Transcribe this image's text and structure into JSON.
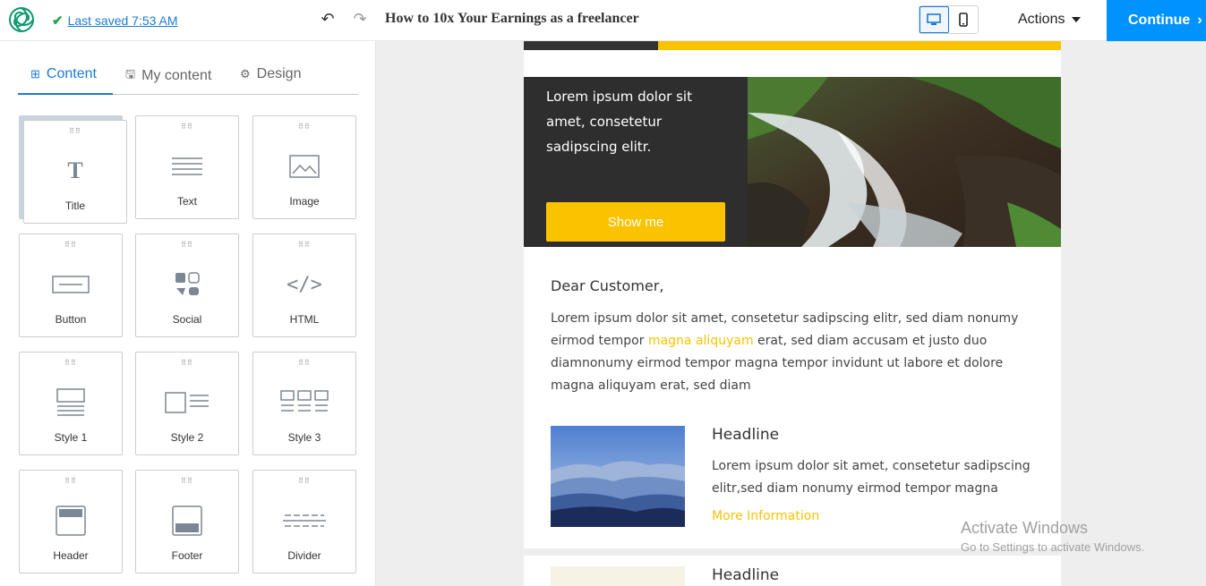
{
  "topbar": {
    "logo_icon": "sendinblue-spiral-icon",
    "last_saved": "Last saved 7:53 AM",
    "undo_icon": "undo-icon",
    "redo_icon": "redo-icon",
    "document_title": "How to 10x Your Earnings as a freelancer",
    "device_desktop_icon": "desktop-icon",
    "device_mobile_icon": "mobile-icon",
    "actions_label": "Actions",
    "continue_label": "Continue",
    "accent_color": "#0092ff"
  },
  "sidebar": {
    "tabs": [
      {
        "label": "Content",
        "icon": "grid-icon",
        "active": true
      },
      {
        "label": "My content",
        "icon": "save-icon",
        "active": false
      },
      {
        "label": "Design",
        "icon": "gear-icon",
        "active": false
      }
    ],
    "blocks": [
      {
        "label": "Title",
        "icon": "title-icon"
      },
      {
        "label": "Text",
        "icon": "text-icon"
      },
      {
        "label": "Image",
        "icon": "image-icon"
      },
      {
        "label": "Button",
        "icon": "button-icon"
      },
      {
        "label": "Social",
        "icon": "social-icon"
      },
      {
        "label": "HTML",
        "icon": "code-icon"
      },
      {
        "label": "Style 1",
        "icon": "style1-icon"
      },
      {
        "label": "Style 2",
        "icon": "style2-icon"
      },
      {
        "label": "Style 3",
        "icon": "style3-icon"
      },
      {
        "label": "Header",
        "icon": "header-icon"
      },
      {
        "label": "Footer",
        "icon": "footer-icon"
      },
      {
        "label": "Divider",
        "icon": "divider-icon"
      }
    ]
  },
  "email": {
    "hero_text": "Lorem ipsum dolor sit amet, consetetur sadipscing elitr.",
    "hero_button": "Show me",
    "greeting": "Dear Customer,",
    "paragraph_before": "Lorem ipsum dolor sit amet, consetetur sadipscing elitr, sed diam nonumy eirmod tempor ",
    "paragraph_link": "magna aliquyam",
    "paragraph_after": " erat, sed diam accusam et justo duo diamnonumy eirmod tempor magna tempor invidunt ut labore et dolore magna aliquyam erat, sed diam",
    "card1_headline": "Headline",
    "card1_text": "Lorem ipsum dolor sit amet, consetetur sadipscing elitr,sed diam nonumy eirmod tempor magna",
    "card1_link": "More Information",
    "card2_headline": "Headline",
    "accent_color": "#fbc200"
  },
  "watermark": {
    "line1": "Activate Windows",
    "line2": "Go to Settings to activate Windows."
  }
}
